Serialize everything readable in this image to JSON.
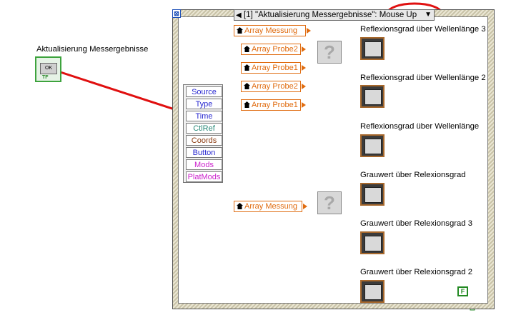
{
  "control": {
    "label": "Aktualisierung Messergebnisse",
    "button_text": "OK",
    "type_badge": "TF"
  },
  "event_structure": {
    "selector": "[1] \"Aktualisierung Messergebnisse\": Mouse Up",
    "stop_glyph": "⊠",
    "event_data": [
      "Source",
      "Type",
      "Time",
      "CtlRef",
      "Coords",
      "Button",
      "Mods",
      "PlatMods"
    ],
    "event_data_colors": [
      "#2a2ad0",
      "#2a2ad0",
      "#2a2ad0",
      "#2a8a7a",
      "#8a3a10",
      "#2a2ad0",
      "#cc22cc",
      "#cc22cc"
    ]
  },
  "local_variables": [
    "Array Messung",
    "Array Probe2",
    "Array Probe1",
    "Array Probe2",
    "Array Probe1",
    "Array Messung"
  ],
  "select_glyph": "?",
  "graphs": [
    "Reflexionsgrad über Wellenlänge 3",
    "Reflexionsgrad über Wellenlänge 2",
    "Reflexionsgrad über Wellenlänge",
    "Grauwert über Relexionsgrad",
    "Grauwert über Relexionsgrad 3",
    "Grauwert über Relexionsgrad 2"
  ],
  "false_constant": "F",
  "colors": {
    "wire_orange": "#c8641e",
    "wire_brown": "#8a4a1a",
    "annotation_red": "#e01010",
    "boolean_green": "#2a9a2a"
  }
}
